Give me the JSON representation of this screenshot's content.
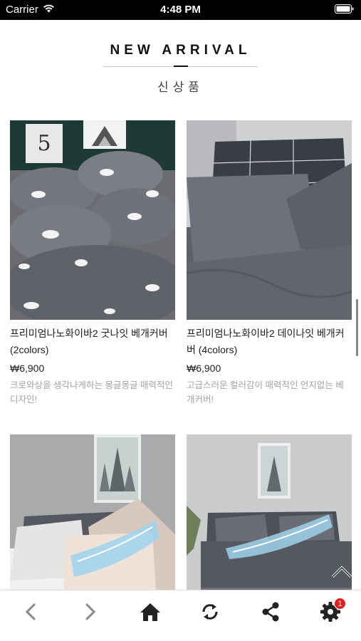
{
  "status_bar": {
    "carrier": "Carrier",
    "time": "4:48 PM"
  },
  "section": {
    "title": "NEW ARRIVAL",
    "subtitle": "신상품"
  },
  "products": [
    {
      "name": "프리미엄나노화이바2 굿나잇 베개커버 (2colors)",
      "price": "₩6,900",
      "description": "크로와상을 생각나게하는 몽글몽글 매력적인 디자인!"
    },
    {
      "name": "프리미엄나노화이바2 데이나잇 베개커버 (4colors)",
      "price": "₩6,900",
      "description": "고급스러운 컬러감이 매력적인 언지없는 베개커버!"
    },
    {
      "name": "",
      "price": "",
      "description": ""
    },
    {
      "name": "",
      "price": "",
      "description": ""
    }
  ],
  "toolbar": {
    "items": [
      {
        "icon": "chevron-left-icon"
      },
      {
        "icon": "chevron-right-icon"
      },
      {
        "icon": "home-icon"
      },
      {
        "icon": "refresh-icon"
      },
      {
        "icon": "share-icon"
      },
      {
        "icon": "gear-icon",
        "badge": "1"
      }
    ]
  },
  "colors": {
    "accent_badge": "#e02020",
    "status_bar_bg": "#000000",
    "description_text": "#a3a3a3"
  }
}
